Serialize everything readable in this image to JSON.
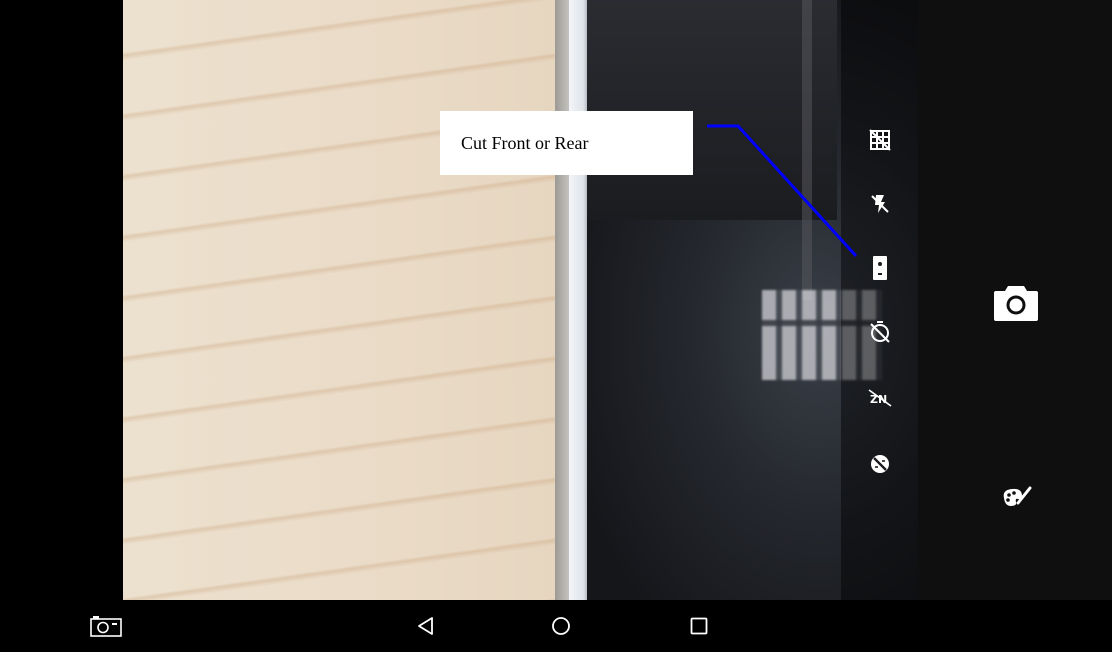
{
  "annotation": {
    "label": "Cut Front or Rear",
    "line_color": "#0000ff"
  },
  "toolbar": {
    "items": [
      {
        "icon": "grid-off-icon"
      },
      {
        "icon": "flash-off-icon"
      },
      {
        "icon": "switch-camera-icon"
      },
      {
        "icon": "timer-off-icon"
      },
      {
        "icon": "hdr-off-icon"
      },
      {
        "icon": "exposure-icon"
      }
    ]
  },
  "controls": {
    "shutter_icon": "camera-shutter-icon",
    "effects_icon": "palette-icon",
    "mode_icon": "camera-mode-icon"
  },
  "navigation": {
    "back_icon": "back-triangle-icon",
    "home_icon": "home-circle-icon",
    "recents_icon": "recents-square-icon"
  },
  "colors": {
    "background": "#000000",
    "icon": "#ffffff"
  }
}
